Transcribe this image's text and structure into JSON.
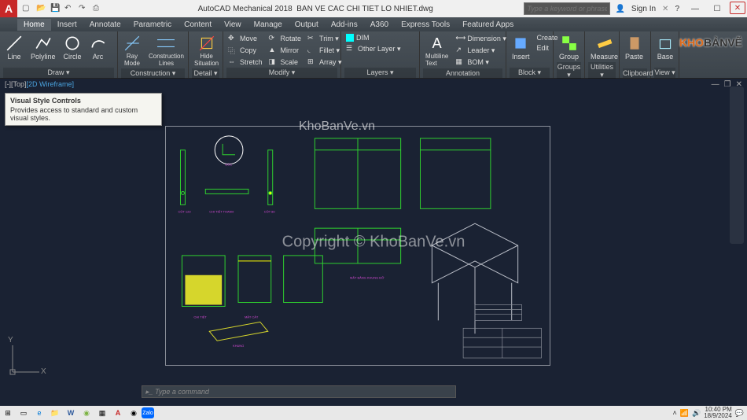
{
  "titlebar": {
    "app": "AutoCAD Mechanical 2018",
    "file": "BAN VE CAC CHI TIET LO NHIET.dwg",
    "search_placeholder": "Type a keyword or phrase",
    "signin": "Sign In"
  },
  "menutabs": [
    "Home",
    "Insert",
    "Annotate",
    "Parametric",
    "Content",
    "View",
    "Manage",
    "Output",
    "Add-ins",
    "A360",
    "Express Tools",
    "Featured Apps"
  ],
  "ribbon": {
    "draw": {
      "label": "Draw ▾",
      "items": [
        "Line",
        "Polyline",
        "Circle",
        "Arc"
      ]
    },
    "construction": {
      "label": "Construction ▾",
      "ray": "Ray Mode",
      "clines": "Construction Lines"
    },
    "detail": {
      "label": "Detail ▾",
      "hide": "Hide Situation"
    },
    "modify": {
      "label": "Modify ▾",
      "move": "Move",
      "rotate": "Rotate",
      "trim": "Trim ▾",
      "array": "Array ▾",
      "copy": "Copy",
      "mirror": "Mirror",
      "fillet": "Fillet ▾",
      "stretch": "Stretch",
      "scale": "Scale"
    },
    "layers": {
      "label": "Layers ▾",
      "other": "Other Layer ▾",
      "dim": "DIM"
    },
    "annotation": {
      "label": "Annotation",
      "ml": "Multiline Text",
      "dim": "Dimension ▾",
      "leader": "Leader ▾",
      "bom": "BOM ▾"
    },
    "block": {
      "label": "Block ▾",
      "insert": "Insert",
      "create": "Create",
      "edit": "Edit"
    },
    "groups": {
      "label": "Groups ▾",
      "group": "Group"
    },
    "utilities": {
      "label": "Utilities ▾",
      "measure": "Measure"
    },
    "clipboard": {
      "label": "Clipboard",
      "paste": "Paste"
    },
    "view": {
      "label": "View ▾",
      "base": "Base"
    }
  },
  "viewport": {
    "label_top": "[-][Top]",
    "label_wf": "[2D Wireframe]",
    "tooltip_title": "Visual Style Controls",
    "tooltip_body": "Provides access to standard and custom visual styles."
  },
  "cmdline": "Type a command",
  "ucs": {
    "x": "X",
    "y": "Y"
  },
  "watermark_center": "KhoBanVe.vn",
  "watermark": "Copyright © KhoBanVe.vn",
  "logo": {
    "kho": "KHO",
    "ban": "BẢN",
    "ve": "VẼ"
  },
  "taskbar": {
    "time": "10:40 PM",
    "date": "18/9/2024"
  },
  "drawing_labels": {
    "l1": "CHI TIẾT",
    "l2": "MẶT BẰNG KHUNG ĐỠ",
    "l3": "ĐƯỜNG"
  }
}
